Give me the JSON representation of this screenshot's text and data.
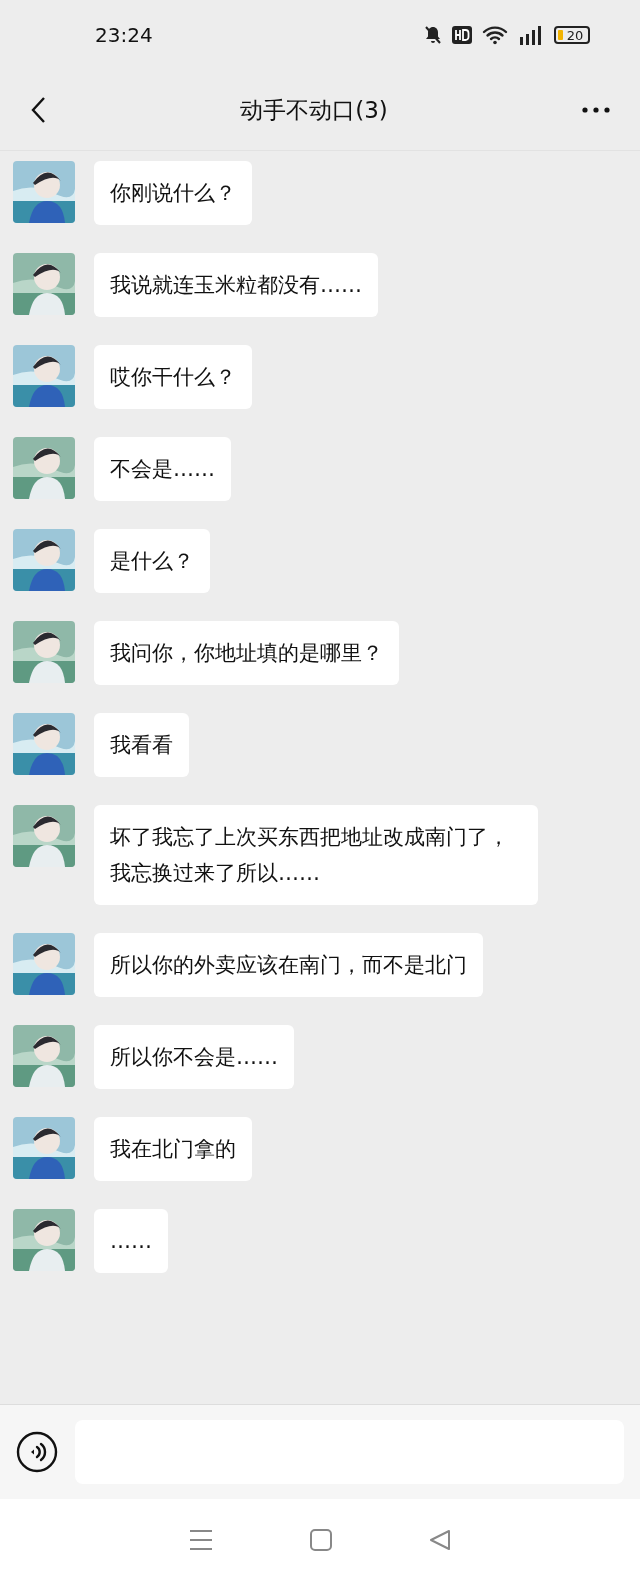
{
  "status_bar": {
    "time": "23:24",
    "battery": "20"
  },
  "header": {
    "title": "动手不动口(3)"
  },
  "messages": [
    {
      "text": "你刚说什么？"
    },
    {
      "text": "我说就连玉米粒都没有……"
    },
    {
      "text": "哎你干什么？"
    },
    {
      "text": "不会是……"
    },
    {
      "text": "是什么？"
    },
    {
      "text": "我问你，你地址填的是哪里？"
    },
    {
      "text": "我看看"
    },
    {
      "text": "坏了我忘了上次买东西把地址改成南门了，我忘换过来了所以……"
    },
    {
      "text": "所以你的外卖应该在南门，而不是北门"
    },
    {
      "text": "所以你不会是……"
    },
    {
      "text": "我在北门拿的"
    },
    {
      "text": "……"
    }
  ]
}
